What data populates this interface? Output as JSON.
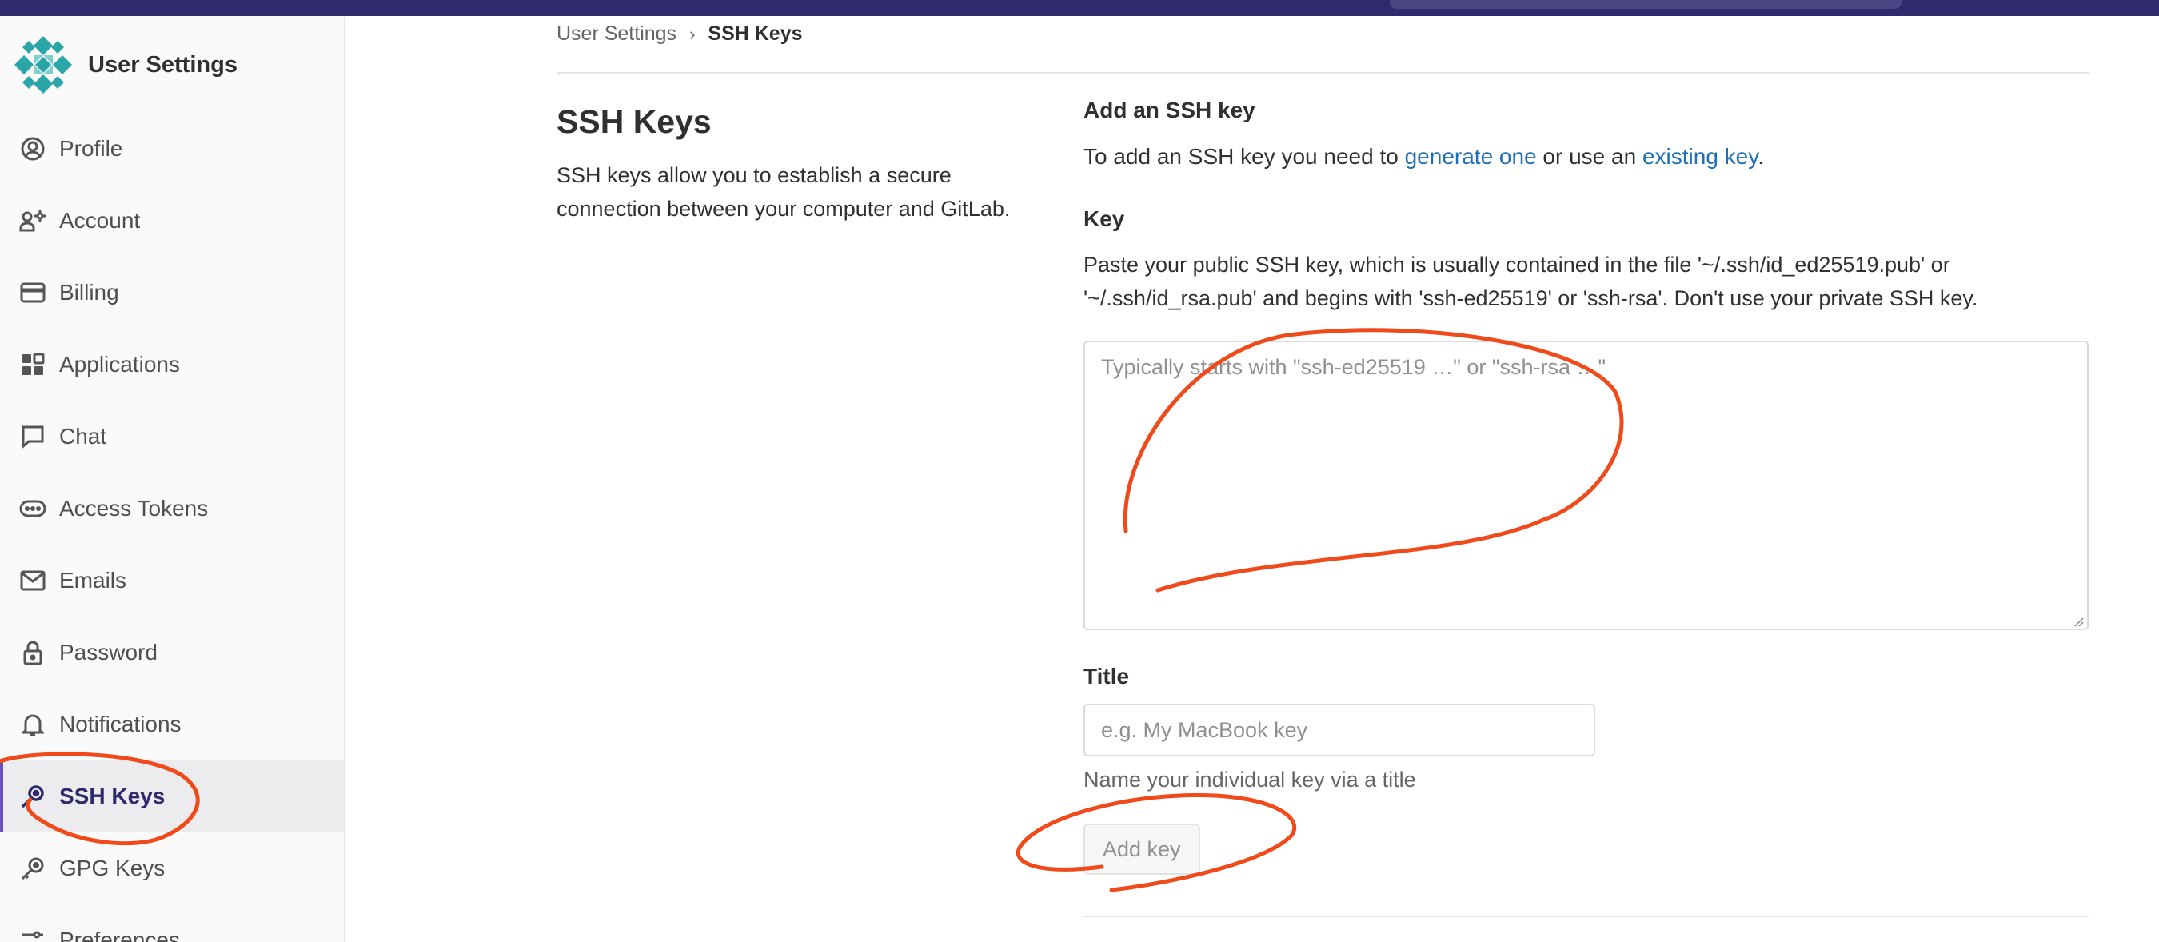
{
  "sidebar": {
    "title": "User Settings",
    "items": [
      {
        "label": "Profile",
        "icon": "profile-icon"
      },
      {
        "label": "Account",
        "icon": "account-icon"
      },
      {
        "label": "Billing",
        "icon": "billing-icon"
      },
      {
        "label": "Applications",
        "icon": "applications-icon"
      },
      {
        "label": "Chat",
        "icon": "chat-icon"
      },
      {
        "label": "Access Tokens",
        "icon": "access-tokens-icon"
      },
      {
        "label": "Emails",
        "icon": "email-icon"
      },
      {
        "label": "Password",
        "icon": "lock-icon"
      },
      {
        "label": "Notifications",
        "icon": "bell-icon"
      },
      {
        "label": "SSH Keys",
        "icon": "key-icon",
        "active": true
      },
      {
        "label": "GPG Keys",
        "icon": "key-icon"
      },
      {
        "label": "Preferences",
        "icon": "preferences-icon"
      }
    ]
  },
  "breadcrumb": {
    "parent": "User Settings",
    "separator": "›",
    "current": "SSH Keys"
  },
  "intro": {
    "title": "SSH Keys",
    "description": "SSH keys allow you to establish a secure connection between your computer and GitLab."
  },
  "form": {
    "section_title": "Add an SSH key",
    "add_text_before": "To add an SSH key you need to ",
    "generate_link": "generate one",
    "add_text_middle": " or use an ",
    "existing_link": "existing key",
    "add_text_after": ".",
    "key_label": "Key",
    "key_help": "Paste your public SSH key, which is usually contained in the file '~/.ssh/id_ed25519.pub' or '~/.ssh/id_rsa.pub' and begins with 'ssh-ed25519' or 'ssh-rsa'. Don't use your private SSH key.",
    "key_placeholder": "Typically starts with \"ssh-ed25519 …\" or \"ssh-rsa …\"",
    "title_label": "Title",
    "title_placeholder": "e.g. My MacBook key",
    "title_help": "Name your individual key via a title",
    "submit_label": "Add key"
  },
  "colors": {
    "topbar": "#2f2a6b",
    "link": "#1f6fb5",
    "active_nav": "#2f2a6b",
    "annotation_stroke": "#f04a1a"
  }
}
